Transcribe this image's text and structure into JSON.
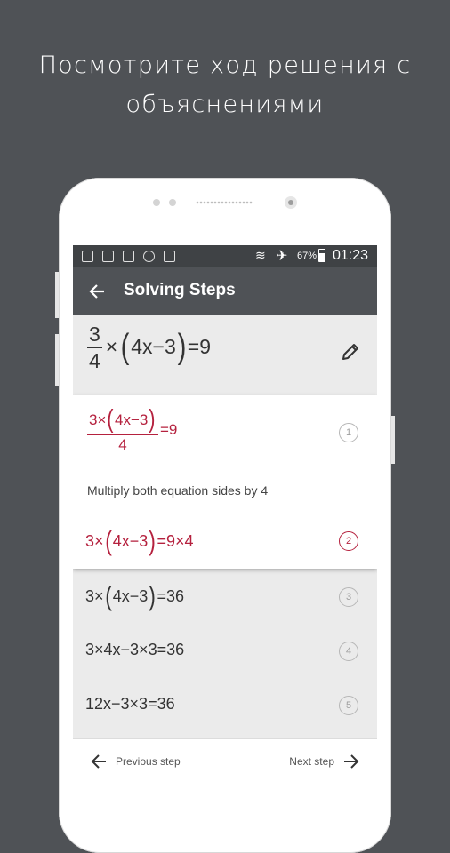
{
  "headline": {
    "line1": "Посмотрите ход решения с",
    "line2": "объяснениями"
  },
  "statusbar": {
    "battery": "67%",
    "time": "01:23",
    "icons": [
      "notification-icon",
      "image-icon",
      "mail-icon",
      "sync-icon",
      "task-icon",
      "wifi-icon",
      "airplane-icon",
      "battery-icon"
    ]
  },
  "appbar": {
    "title": "Solving Steps",
    "back_icon": "arrow-back-icon"
  },
  "equation": {
    "frac_num": "3",
    "frac_den": "4",
    "times": "×",
    "lparen": "(",
    "inner": "4x−3",
    "rparen": ")",
    "eq": "=",
    "rhs": "9",
    "edit_icon": "pencil-icon"
  },
  "steps": [
    {
      "number": "1",
      "num": "3×",
      "lparen": "(",
      "inner": "4x−3",
      "rparen": ")",
      "den": "4",
      "rest": "=9"
    },
    {
      "explanation": "Multiply both equation sides by 4"
    },
    {
      "number": "2",
      "pre": "3×",
      "lparen": "(",
      "inner": "4x−3",
      "rparen": ")",
      "rest": "=9×4"
    },
    {
      "number": "3",
      "pre": "3×",
      "lparen": "(",
      "inner": "4x−3",
      "rparen": ")",
      "rest": "=36"
    },
    {
      "number": "4",
      "text": "3×4x−3×3=36"
    },
    {
      "number": "5",
      "text": "12x−3×3=36"
    }
  ],
  "nav": {
    "previous": "Previous step",
    "next": "Next step",
    "prev_icon": "arrow-left-icon",
    "next_icon": "arrow-right-icon"
  },
  "colors": {
    "accent": "#b5213e",
    "appbar": "#4f5256",
    "statusbar": "#3f4245",
    "background": "#4f5256"
  }
}
